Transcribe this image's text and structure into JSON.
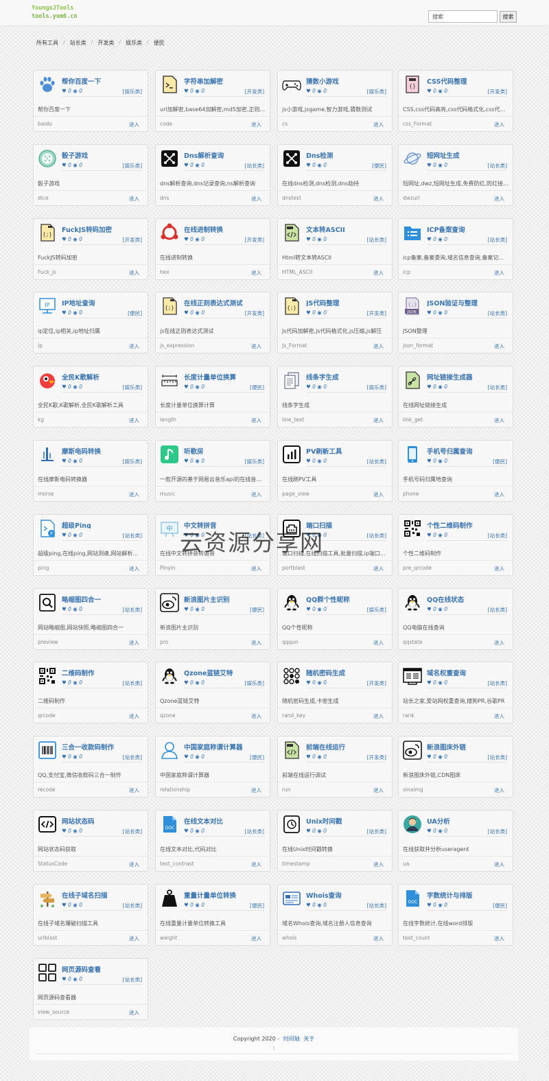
{
  "header": {
    "logo_line1": "YoungxJTools",
    "logo_line2": "tools.yum6.cn",
    "search_placeholder": "搜索",
    "search_button": "搜索"
  },
  "breadcrumb": [
    "所有工具",
    "站长类",
    "开发类",
    "娱乐类",
    "便民"
  ],
  "likes": "0",
  "views": "0",
  "enter_label": "进入",
  "cards": [
    {
      "title": "帮你百度一下",
      "cat": "[娱乐类]",
      "desc": "帮你百度一下",
      "slug": "baidu",
      "icon": "baidu-paw-icon"
    },
    {
      "title": "字符串加解密",
      "cat": "[开发类]",
      "desc": "url加解密,base64加解密,md5加密,正则...",
      "slug": "code",
      "icon": "terminal-file-icon"
    },
    {
      "title": "猜数小游戏",
      "cat": "[娱乐类]",
      "desc": "js小游戏,jsgame,智力游戏,猜数测试",
      "slug": "cs",
      "icon": "gamepad-icon"
    },
    {
      "title": "CSS代码整理",
      "cat": "[开发类]",
      "desc": "CSS,css代码高亮,css代码格式化,css代码...",
      "slug": "css_Format",
      "icon": "css-file-icon"
    },
    {
      "title": "骰子游戏",
      "cat": "[娱乐类]",
      "desc": "骰子游戏",
      "slug": "dice",
      "icon": "dice-icon"
    },
    {
      "title": "Dns解析查询",
      "cat": "[站长类]",
      "desc": "dns解析查询,dns记录查询,ns解析查询",
      "slug": "dns",
      "icon": "dns-network-icon"
    },
    {
      "title": "Dns检测",
      "cat": "[便民]",
      "desc": "在线dns检测,dns检测,dns劫持",
      "slug": "dnstest",
      "icon": "dns-network-icon"
    },
    {
      "title": "短网址生成",
      "cat": "[站长类]",
      "desc": "短网址,dwz,短网址生成,免费防红,防红接...",
      "slug": "dwzurl",
      "icon": "planet-icon"
    },
    {
      "title": "FuckJS转码加密",
      "cat": "[开发类]",
      "desc": "FuckJS转码加密",
      "slug": "Fuck_js",
      "icon": "js-file-icon"
    },
    {
      "title": "在线进制转换",
      "cat": "[开发类]",
      "desc": "在线进制转换",
      "slug": "hex",
      "icon": "share-nodes-icon"
    },
    {
      "title": "文本转ASCII",
      "cat": "[站长类]",
      "desc": "Html转文本转ASCII",
      "slug": "HTML_ASCII",
      "icon": "html-file-icon"
    },
    {
      "title": "ICP备案查询",
      "cat": "[站长类]",
      "desc": "icp备案,备案查询,域名信息查询,备案记...",
      "slug": "icp",
      "icon": "folder-list-icon"
    },
    {
      "title": "IP地址查询",
      "cat": "[便民]",
      "desc": "ip定位,ip相关,ip地址归属",
      "slug": "ip",
      "icon": "ip-monitor-icon"
    },
    {
      "title": "在线正则表达式测试",
      "cat": "[开发类]",
      "desc": "js在线正则表达式测试",
      "slug": "js_expression",
      "icon": "js-file-icon"
    },
    {
      "title": "JS代码整理",
      "cat": "[开发类]",
      "desc": "Js代码加解密,js代码格式化,js压缩,js解压",
      "slug": "Js_Format",
      "icon": "js-file-icon"
    },
    {
      "title": "JSON验证与整理",
      "cat": "[站长类]",
      "desc": "JSON整理",
      "slug": "json_format",
      "icon": "json-file-icon"
    },
    {
      "title": "全民K歌解析",
      "cat": "[娱乐类]",
      "desc": "全民K歌,K歌解析,全民K歌解析工具",
      "slug": "kg",
      "icon": "kg-bird-icon"
    },
    {
      "title": "长度计量单位换算",
      "cat": "[便民]",
      "desc": "长度计量单位换算计算",
      "slug": "length",
      "icon": "ruler-icon"
    },
    {
      "title": "线条字生成",
      "cat": "[娱乐类]",
      "desc": "线条字生成",
      "slug": "line_text",
      "icon": "documents-icon"
    },
    {
      "title": "网址链接生成器",
      "cat": "[站长类]",
      "desc": "在线网址链接生成",
      "slug": "link_get",
      "icon": "link-file-icon"
    },
    {
      "title": "摩斯电码转换",
      "cat": "[娱乐类]",
      "desc": "在线摩斯电码转换器",
      "slug": "morse",
      "icon": "morse-icon"
    },
    {
      "title": "听歌房",
      "cat": "[娱乐类]",
      "desc": "一款开源的基于网易云音乐api的在线音...",
      "slug": "music",
      "icon": "music-note-icon"
    },
    {
      "title": "PV刷新工具",
      "cat": "[站长类]",
      "desc": "在线刷PV工具",
      "slug": "page_view",
      "icon": "bar-chart-icon"
    },
    {
      "title": "手机号归属查询",
      "cat": "[便民]",
      "desc": "手机号码归属地查询",
      "slug": "phone",
      "icon": "mobile-phone-icon"
    },
    {
      "title": "超级Ping",
      "cat": "[站长类]",
      "desc": "超级ping,在线ping,网站测速,网站解析...",
      "slug": "ping",
      "icon": "ping-terminal-icon"
    },
    {
      "title": "中文转拼音",
      "cat": "[站长类]",
      "desc": "在线中文转拼音转语音",
      "slug": "Pinyin",
      "icon": "pinyin-board-icon"
    },
    {
      "title": "端口扫描",
      "cat": "[站长类]",
      "desc": "端口扫描,在线扫描工具,批量扫描,ip端口...",
      "slug": "portblast",
      "icon": "port-scan-icon"
    },
    {
      "title": "个性二维码制作",
      "cat": "[站长类]",
      "desc": "个性二维码制作",
      "slug": "pre_qrcode",
      "icon": "qrcode-icon"
    },
    {
      "title": "略缩图四合一",
      "cat": "[站长类]",
      "desc": "网站略缩图,网站快照,略缩图四合一",
      "slug": "preview",
      "icon": "magnifier-file-icon"
    },
    {
      "title": "新浪图片主识别",
      "cat": "[便民]",
      "desc": "新浪图片主识别",
      "slug": "pro",
      "icon": "weibo-icon"
    },
    {
      "title": "QQ群个性昵称",
      "cat": "[娱乐类]",
      "desc": "QQ个性昵称",
      "slug": "qqqun",
      "icon": "qq-penguin-icon"
    },
    {
      "title": "QQ在线状态",
      "cat": "[站长类]",
      "desc": "QQ电脑在线查询",
      "slug": "qqstate",
      "icon": "qq-penguin-icon"
    },
    {
      "title": "二维码制作",
      "cat": "[站长类]",
      "desc": "二维码制作",
      "slug": "qrcode",
      "icon": "qrcode-icon"
    },
    {
      "title": "Qzone蓝链艾特",
      "cat": "[娱乐类]",
      "desc": "Qzone蓝链艾特",
      "slug": "qzone",
      "icon": "qq-penguin-icon"
    },
    {
      "title": "随机密码生成",
      "cat": "[开发类]",
      "desc": "随机密码生成,卡密生成",
      "slug": "rand_key",
      "icon": "dot-grid-icon"
    },
    {
      "title": "域名权重查询",
      "cat": "[站长类]",
      "desc": "站长之家,爱站网权重查询,搜狗PR,谷歌PR",
      "slug": "rank",
      "icon": "browser-window-icon"
    },
    {
      "title": "三合一收款码制作",
      "cat": "[站长类]",
      "desc": "QQ,支付宝,微信收款码三合一制作",
      "slug": "recode",
      "icon": "barcode-icon"
    },
    {
      "title": "中国家庭称谓计算器",
      "cat": "[便民]",
      "desc": "中国家庭称谓计算器",
      "slug": "relationship",
      "icon": "person-icon"
    },
    {
      "title": "前端在线运行",
      "cat": "[开发类]",
      "desc": "前端在线运行调试",
      "slug": "run",
      "icon": "html-file-icon"
    },
    {
      "title": "新浪图床外链",
      "cat": "[站长类]",
      "desc": "新浪图床外链,CDN图床",
      "slug": "sinaimg",
      "icon": "weibo-icon"
    },
    {
      "title": "网站状态码",
      "cat": "[站长类]",
      "desc": "网站状态码获取",
      "slug": "StatusCode",
      "icon": "code-brackets-icon"
    },
    {
      "title": "在线文本对比",
      "cat": "[站长类]",
      "desc": "在线文本对比,代码对比",
      "slug": "text_contrast",
      "icon": "doc-file-icon"
    },
    {
      "title": "Unix时间戳",
      "cat": "[站长类]",
      "desc": "在线Unix时间戳转换",
      "slug": "timestamp",
      "icon": "clock-file-icon"
    },
    {
      "title": "UA分析",
      "cat": "[站长类]",
      "desc": "在线获取并分析useragent",
      "slug": "ua",
      "icon": "user-avatar-icon"
    },
    {
      "title": "在线子域名扫描",
      "cat": "[站长类]",
      "desc": "在线子域名爆破扫描工具",
      "slug": "urlblast",
      "icon": "signpost-icon"
    },
    {
      "title": "重量计量单位转换",
      "cat": "[便民]",
      "desc": "在线重量计量单位转换工具",
      "slug": "weight",
      "icon": "weight-icon"
    },
    {
      "title": "Whois查询",
      "cat": "[站长类]",
      "desc": "域名Whois查询,域名注册人信息查询",
      "slug": "whois",
      "icon": "id-card-icon"
    },
    {
      "title": "字数统计与排版",
      "cat": "[便民]",
      "desc": "在线字数统计,在线word排版",
      "slug": "text_count",
      "icon": "doc-file-icon"
    },
    {
      "title": "网页源码查看",
      "cat": "[站长类]",
      "desc": "网页源码查看器",
      "slug": "view_source",
      "icon": "four-squares-icon"
    }
  ],
  "footer": {
    "copyright": "Copyright 2020 -",
    "link1": "时间轴",
    "link2": "关于",
    "colon": ":"
  },
  "watermark": "云资源分享网"
}
